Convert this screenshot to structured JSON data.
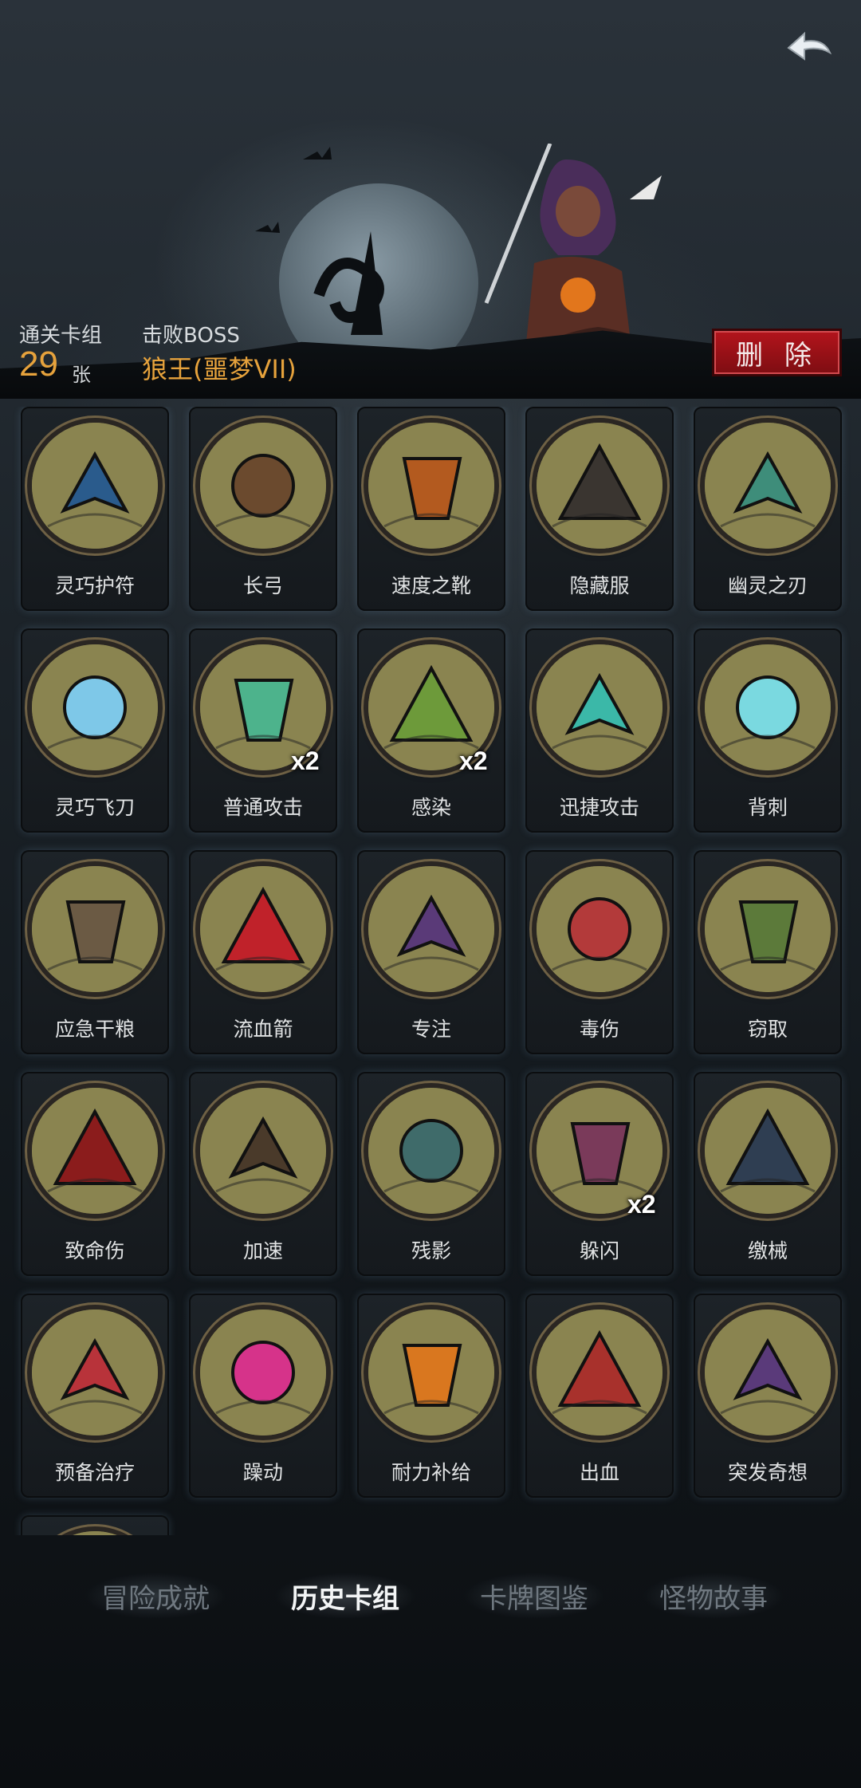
{
  "header": {
    "cleared_deck_label": "通关卡组",
    "deck_count": "29",
    "deck_unit": "张",
    "defeated_boss_label": "击败BOSS",
    "boss_name": "狼王(噩梦VII)",
    "delete_label": "删 除",
    "back_icon": "back-arrow-icon"
  },
  "cards": [
    {
      "name": "灵巧护符",
      "multiplier": "",
      "icon": "amulet-icon",
      "color": "#2a5b8c"
    },
    {
      "name": "长弓",
      "multiplier": "",
      "icon": "longbow-icon",
      "color": "#6b4a2e"
    },
    {
      "name": "速度之靴",
      "multiplier": "",
      "icon": "boots-icon",
      "color": "#b35a1f"
    },
    {
      "name": "隐藏服",
      "multiplier": "",
      "icon": "hooded-cloak-icon",
      "color": "#3a3530"
    },
    {
      "name": "幽灵之刃",
      "multiplier": "",
      "icon": "ghost-blade-icon",
      "color": "#3e8d7a"
    },
    {
      "name": "灵巧飞刀",
      "multiplier": "",
      "icon": "throwing-knives-icon",
      "color": "#7ec8e8"
    },
    {
      "name": "普通攻击",
      "multiplier": "x2",
      "icon": "attack-icon",
      "color": "#4db38c"
    },
    {
      "name": "感染",
      "multiplier": "x2",
      "icon": "infection-icon",
      "color": "#6d9a3a"
    },
    {
      "name": "迅捷攻击",
      "multiplier": "",
      "icon": "swift-strike-icon",
      "color": "#3bb8a8"
    },
    {
      "name": "背刺",
      "multiplier": "",
      "icon": "backstab-icon",
      "color": "#7ad9e0"
    },
    {
      "name": "应急干粮",
      "multiplier": "",
      "icon": "rations-icon",
      "color": "#6b5a44"
    },
    {
      "name": "流血箭",
      "multiplier": "",
      "icon": "bleeding-arrows-icon",
      "color": "#c0222a"
    },
    {
      "name": "专注",
      "multiplier": "",
      "icon": "focus-wizard-icon",
      "color": "#5a3a78"
    },
    {
      "name": "毒伤",
      "multiplier": "",
      "icon": "poison-icon",
      "color": "#b33a3a"
    },
    {
      "name": "窃取",
      "multiplier": "",
      "icon": "steal-icon",
      "color": "#5c7a3a"
    },
    {
      "name": "致命伤",
      "multiplier": "",
      "icon": "mortal-wound-icon",
      "color": "#8b1c1c"
    },
    {
      "name": "加速",
      "multiplier": "",
      "icon": "haste-icon",
      "color": "#4a3a2a"
    },
    {
      "name": "残影",
      "multiplier": "",
      "icon": "afterimage-icon",
      "color": "#3f6b6a"
    },
    {
      "name": "躲闪",
      "multiplier": "x2",
      "icon": "dodge-icon",
      "color": "#7a3a5a"
    },
    {
      "name": "缴械",
      "multiplier": "",
      "icon": "disarm-icon",
      "color": "#2f3e52"
    },
    {
      "name": "预备治疗",
      "multiplier": "",
      "icon": "heal-heart-icon",
      "color": "#b8333a"
    },
    {
      "name": "躁动",
      "multiplier": "",
      "icon": "frenzy-icon",
      "color": "#d6338a"
    },
    {
      "name": "耐力补给",
      "multiplier": "",
      "icon": "stamina-potion-icon",
      "color": "#d9771f"
    },
    {
      "name": "出血",
      "multiplier": "",
      "icon": "bleed-icon",
      "color": "#a8312c"
    },
    {
      "name": "突发奇想",
      "multiplier": "",
      "icon": "idea-icon",
      "color": "#5a3a7a"
    },
    {
      "name": "",
      "multiplier": "",
      "icon": "partial-card-icon",
      "color": "#444444"
    }
  ],
  "nav": {
    "tabs": [
      {
        "label": "冒险成就",
        "active": false
      },
      {
        "label": "历史卡组",
        "active": true
      },
      {
        "label": "卡牌图鉴",
        "active": false
      },
      {
        "label": "怪物故事",
        "active": false
      }
    ]
  },
  "colors": {
    "accent": "#e6a23c",
    "delete": "#a3121a",
    "card_art_bg": "#8a8450"
  }
}
